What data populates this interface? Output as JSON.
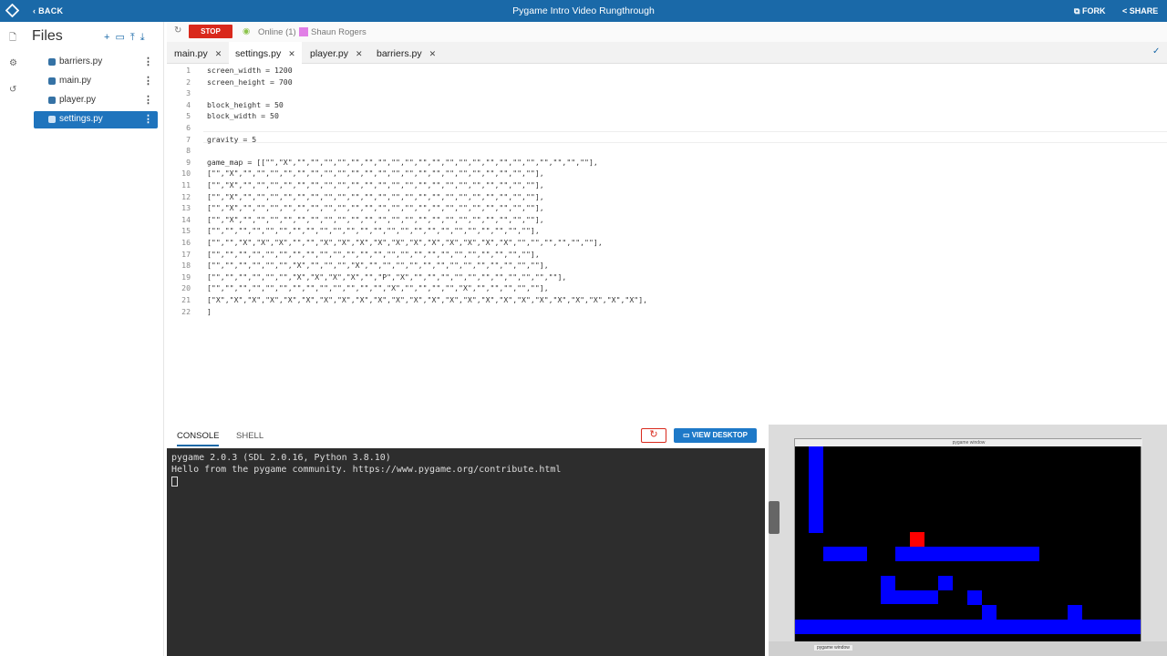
{
  "topbar": {
    "back": "BACK",
    "title": "Pygame Intro Video Rungthrough",
    "fork": "FORK",
    "share": "SHARE"
  },
  "sidebar": {
    "header": "Files",
    "files": [
      {
        "name": "barriers.py"
      },
      {
        "name": "main.py"
      },
      {
        "name": "player.py"
      },
      {
        "name": "settings.py"
      }
    ]
  },
  "toolbar": {
    "stop": "STOP",
    "online": "Online (1)",
    "user": "Shaun Rogers"
  },
  "tabs": [
    "main.py",
    "settings.py",
    "player.py",
    "barriers.py"
  ],
  "editor": {
    "lines": [
      "screen_width = 1200",
      "screen_height = 700",
      "",
      "block_height = 50",
      "block_width = 50",
      "",
      "gravity = 5",
      "",
      "game_map = [[\"\",\"X\",\"\",\"\",\"\",\"\",\"\",\"\",\"\",\"\",\"\",\"\",\"\",\"\",\"\",\"\",\"\",\"\",\"\",\"\",\"\",\"\",\"\",\"\"],",
      "[\"\",\"X\",\"\",\"\",\"\",\"\",\"\",\"\",\"\",\"\",\"\",\"\",\"\",\"\",\"\",\"\",\"\",\"\",\"\",\"\",\"\",\"\",\"\",\"\"],",
      "[\"\",\"X\",\"\",\"\",\"\",\"\",\"\",\"\",\"\",\"\",\"\",\"\",\"\",\"\",\"\",\"\",\"\",\"\",\"\",\"\",\"\",\"\",\"\",\"\"],",
      "[\"\",\"X\",\"\",\"\",\"\",\"\",\"\",\"\",\"\",\"\",\"\",\"\",\"\",\"\",\"\",\"\",\"\",\"\",\"\",\"\",\"\",\"\",\"\",\"\"],",
      "[\"\",\"X\",\"\",\"\",\"\",\"\",\"\",\"\",\"\",\"\",\"\",\"\",\"\",\"\",\"\",\"\",\"\",\"\",\"\",\"\",\"\",\"\",\"\",\"\"],",
      "[\"\",\"X\",\"\",\"\",\"\",\"\",\"\",\"\",\"\",\"\",\"\",\"\",\"\",\"\",\"\",\"\",\"\",\"\",\"\",\"\",\"\",\"\",\"\",\"\"],",
      "[\"\",\"\",\"\",\"\",\"\",\"\",\"\",\"\",\"\",\"\",\"\",\"\",\"\",\"\",\"\",\"\",\"\",\"\",\"\",\"\",\"\",\"\",\"\",\"\"],",
      "[\"\",\"\",\"X\",\"X\",\"X\",\"\",\"\",\"X\",\"X\",\"X\",\"X\",\"X\",\"X\",\"X\",\"X\",\"X\",\"X\",\"X\",\"\",\"\",\"\",\"\",\"\",\"\"],",
      "[\"\",\"\",\"\",\"\",\"\",\"\",\"\",\"\",\"\",\"\",\"\",\"\",\"\",\"\",\"\",\"\",\"\",\"\",\"\",\"\",\"\",\"\",\"\",\"\"],",
      "[\"\",\"\",\"\",\"\",\"\",\"\",\"X\",\"\",\"\",\"\",\"X\",\"\",\"\",\"\",\"\",\"\",\"\",\"\",\"\",\"\",\"\",\"\",\"\",\"\"],",
      "[\"\",\"\",\"\",\"\",\"\",\"\",\"X\",\"X\",\"X\",\"X\",\"\",\"P\",\"X\",\"\",\"\",\"\",\"\",\"\",\"\",\"\",\"\",\"\",\"\",\"\"],",
      "[\"\",\"\",\"\",\"\",\"\",\"\",\"\",\"\",\"\",\"\",\"\",\"\",\"\",\"X\",\"\",\"\",\"\",\"\",\"X\",\"\",\"\",\"\",\"\",\"\"],",
      "[\"X\",\"X\",\"X\",\"X\",\"X\",\"X\",\"X\",\"X\",\"X\",\"X\",\"X\",\"X\",\"X\",\"X\",\"X\",\"X\",\"X\",\"X\",\"X\",\"X\",\"X\",\"X\",\"X\",\"X\"],",
      "]"
    ]
  },
  "panel": {
    "tabs": [
      "CONSOLE",
      "SHELL"
    ],
    "view_desktop": "VIEW DESKTOP",
    "console_lines": [
      "pygame 2.0.3 (SDL 2.0.16, Python 3.8.10)",
      "Hello from the pygame community. https://www.pygame.org/contribute.html"
    ]
  },
  "desktop": {
    "window_title": "pygame window",
    "taskbar_item": "pygame window"
  },
  "colors": {
    "accent": "#1a69a8",
    "stop": "#d9291c",
    "blocks": "#0000ff",
    "player": "#ff0000"
  }
}
